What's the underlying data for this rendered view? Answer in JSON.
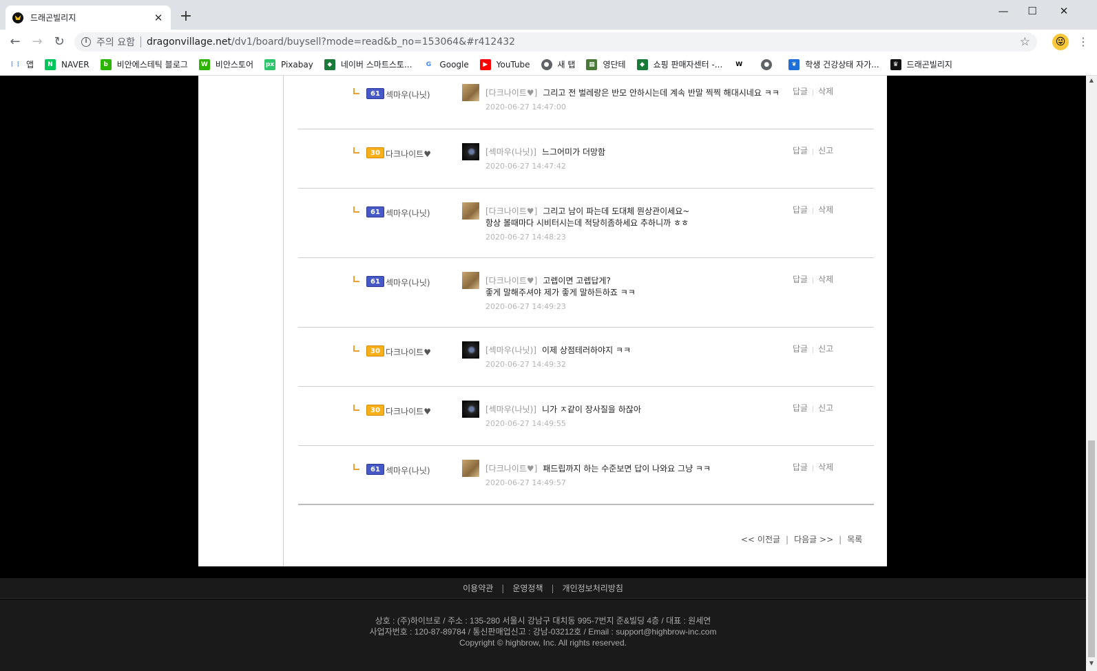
{
  "browser": {
    "tab_title": "드래곤빌리지",
    "security_label": "주의 요함",
    "url_host": "dragonvillage.net",
    "url_rest": "/dv1/board/buysell?mode=read&b_no=153064&#r412432"
  },
  "bookmarks": [
    {
      "label": "앱",
      "icon": "apps-grid-icon",
      "color": "#4285f4"
    },
    {
      "label": "NAVER",
      "icon": "naver-icon",
      "color": "#03c75a"
    },
    {
      "label": "비안에스테틱 블로그",
      "icon": "blog-icon",
      "color": "#2db400"
    },
    {
      "label": "비안스토어",
      "icon": "store-icon",
      "color": "#2db400"
    },
    {
      "label": "Pixabay",
      "icon": "pixabay-icon",
      "color": "#2ec66d"
    },
    {
      "label": "네이버 스마트스토...",
      "icon": "smartstore-icon",
      "color": "#1a7a3a"
    },
    {
      "label": "Google",
      "icon": "google-icon",
      "color": "#4285f4"
    },
    {
      "label": "YouTube",
      "icon": "youtube-icon",
      "color": "#ff0000"
    },
    {
      "label": "새 탭",
      "icon": "globe-icon",
      "color": "#5f6368"
    },
    {
      "label": "영단테",
      "icon": "dict-icon",
      "color": "#4a7a3a"
    },
    {
      "label": "쇼핑 판매자센터 -...",
      "icon": "seller-icon",
      "color": "#1a7a3a"
    },
    {
      "label": "",
      "icon": "wikipedia-icon",
      "color": "#000000"
    },
    {
      "label": "",
      "icon": "globe-icon",
      "color": "#5f6368"
    },
    {
      "label": "학생 건강상태 자가...",
      "icon": "health-icon",
      "color": "#1e6fd9"
    },
    {
      "label": "드래곤빌리지",
      "icon": "dragonvillage-icon",
      "color": "#111111"
    }
  ],
  "comments": [
    {
      "level": "61",
      "lv_color": "b",
      "nick": "섹마우(나닛)",
      "thumb": "tan",
      "tag": "[다크나이트♥]",
      "lines": [
        "그리고 전 벌레랑은 반모 안하시는데 계속 반말 찍찍 해대시네요 ㅋㅋ"
      ],
      "time": "2020-06-27 14:47:00",
      "act1": "답글",
      "act2": "삭제"
    },
    {
      "level": "30",
      "lv_color": "y",
      "nick": "다크나이트♥",
      "thumb": "dark",
      "tag": "[섹마우(나닛)]",
      "lines": [
        "느그어미가 더망함"
      ],
      "time": "2020-06-27 14:47:42",
      "act1": "답글",
      "act2": "신고"
    },
    {
      "level": "61",
      "lv_color": "b",
      "nick": "섹마우(나닛)",
      "thumb": "tan",
      "tag": "[다크나이트♥]",
      "lines": [
        "그리고 남이 파는데 도대체 뭔상관이세요~",
        "항상 볼때마다 시비터시는데 적당히좀하세요 추하니까 ㅎㅎ"
      ],
      "time": "2020-06-27 14:48:23",
      "act1": "답글",
      "act2": "삭제"
    },
    {
      "level": "61",
      "lv_color": "b",
      "nick": "섹마우(나닛)",
      "thumb": "tan",
      "tag": "[다크나이트♥]",
      "lines": [
        "고렙이면 고렙답게?",
        "좋게 말해주셔야 제가 좋게 말하든하죠 ㅋㅋ"
      ],
      "time": "2020-06-27 14:49:23",
      "act1": "답글",
      "act2": "삭제"
    },
    {
      "level": "30",
      "lv_color": "y",
      "nick": "다크나이트♥",
      "thumb": "dark",
      "tag": "[섹마우(나닛)]",
      "lines": [
        "이제 상점테러하야지 ㅋㅋ"
      ],
      "time": "2020-06-27 14:49:32",
      "act1": "답글",
      "act2": "신고"
    },
    {
      "level": "30",
      "lv_color": "y",
      "nick": "다크나이트♥",
      "thumb": "dark",
      "tag": "[섹마우(나닛)]",
      "lines": [
        "니가 ㅈ같이 장사질을 하잖아"
      ],
      "time": "2020-06-27 14:49:55",
      "act1": "답글",
      "act2": "신고"
    },
    {
      "level": "61",
      "lv_color": "b",
      "nick": "섹마우(나닛)",
      "thumb": "tan",
      "tag": "[다크나이트♥]",
      "lines": [
        "패드립까지 하는 수준보면 답이 나와요 그냥 ㅋㅋ"
      ],
      "time": "2020-06-27 14:49:57",
      "act1": "답글",
      "act2": "삭제"
    }
  ],
  "pager": {
    "prev": "<< 이전글",
    "next": "다음글 >>",
    "list": "목록"
  },
  "footer": {
    "links": [
      "이용약관",
      "운영정책",
      "개인정보처리방침"
    ],
    "line1": "상호 : (주)하이브로 / 주소 : 135-280 서울시 강남구 대치동 995-7번지 준&빌딩 4층 / 대표 : 원세연",
    "line2": "사업자번호 : 120-87-89784 / 통신판매업신고 : 강남-03212호 / Email : support@highbrow-inc.com",
    "line3": "Copyright © highbrow, Inc. All rights reserved."
  }
}
